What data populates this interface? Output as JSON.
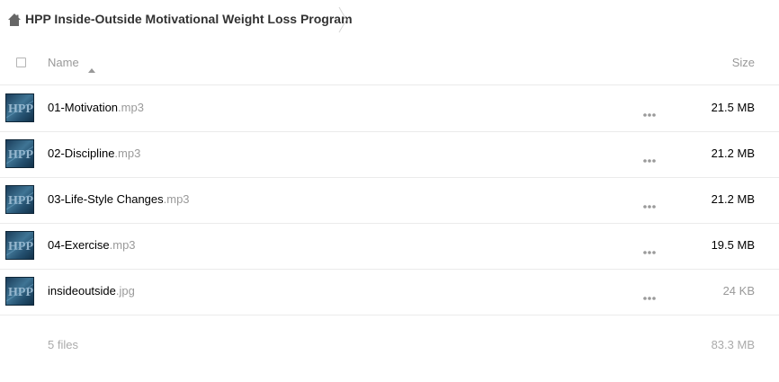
{
  "breadcrumb": {
    "title": "HPP Inside-Outside Motivational Weight Loss Program"
  },
  "header": {
    "name_label": "Name",
    "size_label": "Size",
    "sort_direction": "ascending"
  },
  "files": [
    {
      "name": "01-Motivation",
      "ext": ".mp3",
      "size": "21.5 MB"
    },
    {
      "name": "02-Discipline",
      "ext": ".mp3",
      "size": "21.2 MB"
    },
    {
      "name": "03-Life-Style Changes",
      "ext": ".mp3",
      "size": "21.2 MB"
    },
    {
      "name": "04-Exercise",
      "ext": ".mp3",
      "size": "19.5 MB"
    },
    {
      "name": "insideoutside",
      "ext": ".jpg",
      "size": "24 KB"
    }
  ],
  "summary": {
    "count": "5 files",
    "total_size": "83.3 MB"
  },
  "colors": {
    "border": "#ebebeb",
    "muted_text": "#999999",
    "icon_gray": "#9a9a9a"
  }
}
